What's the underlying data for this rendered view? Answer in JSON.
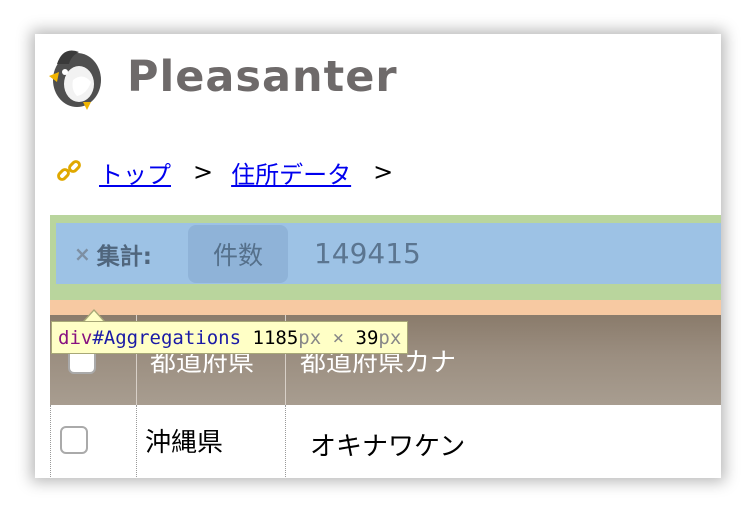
{
  "header": {
    "brand": "Pleasanter"
  },
  "breadcrumb": {
    "items": [
      {
        "label": "トップ"
      },
      {
        "label": "住所データ"
      }
    ],
    "separator": ">"
  },
  "aggregations": {
    "title": "集計:",
    "close_symbol": "×",
    "chip_label": "件数",
    "value": "149415"
  },
  "table": {
    "columns": [
      "都道府県",
      "都道府県カナ"
    ],
    "rows": [
      {
        "prefecture": "沖縄県",
        "prefecture_kana": "オキナワケン"
      }
    ]
  },
  "devtools_tooltip": {
    "tag": "div",
    "id": "#Aggregations",
    "width": "1185",
    "height": "39",
    "unit": "px",
    "times": "×"
  },
  "colors": {
    "aggregations_bg": "#9dc2e5",
    "highlight_border": "#b9d59d",
    "highlight_margin": "#f7c9a2",
    "header_bg": "#9b8e80",
    "link": "#0000ee"
  },
  "icons": [
    "owl-logo-icon",
    "link-chain-icon",
    "close-icon",
    "checkbox-icon"
  ]
}
